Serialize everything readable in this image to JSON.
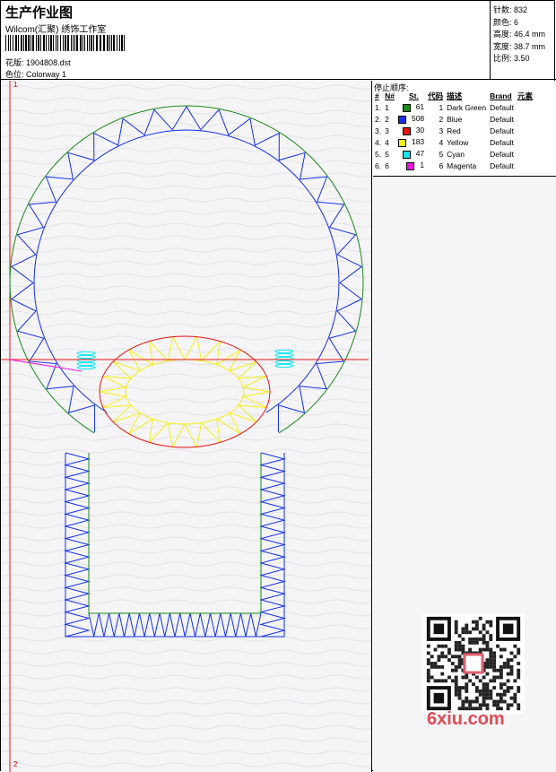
{
  "header": {
    "title": "生产作业图",
    "company": "Wilcom(汇聚) 绣饰工作室",
    "pattern_label": "花版:",
    "pattern_value": "1904808.dst",
    "colorway_label": "色位:",
    "colorway_value": "Colorway 1"
  },
  "stats": {
    "stitches_label": "针数:",
    "stitches_value": "832",
    "colors_label": "颜色:",
    "colors_value": "6",
    "height_label": "高度:",
    "height_value": "46.4 mm",
    "width_label": "宽度:",
    "width_value": "38.7 mm",
    "scale_label": "比例:",
    "scale_value": "3.50"
  },
  "stop_sequence": {
    "title": "停止顺序:",
    "columns": [
      "#",
      "N#",
      "St.",
      "代码",
      "描述",
      "Brand",
      "元素"
    ],
    "rows": [
      {
        "idx": "1.",
        "n": "1",
        "color": "#1a8a1a",
        "st": "61",
        "code": "1",
        "desc": "Dark Green",
        "brand": "Default"
      },
      {
        "idx": "2.",
        "n": "2",
        "color": "#1432e6",
        "st": "508",
        "code": "2",
        "desc": "Blue",
        "brand": "Default"
      },
      {
        "idx": "3.",
        "n": "3",
        "color": "#e61414",
        "st": "30",
        "code": "3",
        "desc": "Red",
        "brand": "Default"
      },
      {
        "idx": "4.",
        "n": "4",
        "color": "#f5f014",
        "st": "183",
        "code": "4",
        "desc": "Yellow",
        "brand": "Default"
      },
      {
        "idx": "5.",
        "n": "5",
        "color": "#14e6f0",
        "st": "47",
        "code": "5",
        "desc": "Cyan",
        "brand": "Default"
      },
      {
        "idx": "6.",
        "n": "6",
        "color": "#f014e6",
        "st": "1",
        "code": "6",
        "desc": "Magenta",
        "brand": "Default"
      }
    ]
  },
  "canvas": {
    "marker_top": "1",
    "marker_bottom": "2"
  },
  "watermark": "6xiu.com"
}
